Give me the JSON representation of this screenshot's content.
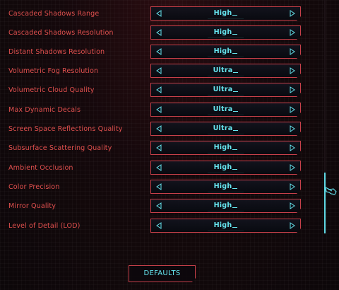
{
  "settings": [
    {
      "label": "Cascaded Shadows Range",
      "value": "High"
    },
    {
      "label": "Cascaded Shadows Resolution",
      "value": "High"
    },
    {
      "label": "Distant Shadows Resolution",
      "value": "High"
    },
    {
      "label": "Volumetric Fog Resolution",
      "value": "Ultra"
    },
    {
      "label": "Volumetric Cloud Quality",
      "value": "Ultra"
    },
    {
      "label": "Max Dynamic Decals",
      "value": "Ultra"
    },
    {
      "label": "Screen Space Reflections Quality",
      "value": "Ultra"
    },
    {
      "label": "Subsurface Scattering Quality",
      "value": "High"
    },
    {
      "label": "Ambient Occlusion",
      "value": "High"
    },
    {
      "label": "Color Precision",
      "value": "High"
    },
    {
      "label": "Mirror Quality",
      "value": "High"
    },
    {
      "label": "Level of Detail (LOD)",
      "value": "High"
    }
  ],
  "defaults_label": "DEFAULTS",
  "icons": {
    "left_arrow": "triangle-left-icon",
    "right_arrow": "triangle-right-icon",
    "scroll_cursor": "hand-cursor-icon"
  },
  "colors": {
    "label": "#e0504e",
    "value": "#66e6f0",
    "border": "#c8404a",
    "background": "#14080b"
  }
}
